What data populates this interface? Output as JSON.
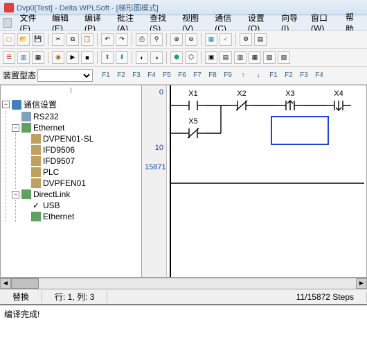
{
  "title": "Dvp0[Test] - Delta WPLSoft - [梯形图模式]",
  "menu": [
    "文件(F)",
    "编辑(E)",
    "编译(P)",
    "批注(A)",
    "查找(S)",
    "视图(V)",
    "通信(C)",
    "设置(Q)",
    "向导(I)",
    "窗口(W)",
    "帮助"
  ],
  "combo": {
    "label": "装置型态",
    "value": ""
  },
  "fkeys": [
    "F1",
    "F2",
    "F3",
    "F4",
    "F5",
    "F6",
    "F7",
    "F8",
    "F9",
    "↑",
    "↓",
    "F1",
    "F2",
    "F3",
    "F4"
  ],
  "tree": {
    "root": "通信设置",
    "rs232": "RS232",
    "ethernet": "Ethernet",
    "eth_children": [
      "DVPEN01-SL",
      "IFD9506",
      "IFD9507",
      "PLC",
      "DVPFEN01"
    ],
    "directlink": "DirectLink",
    "usb": "USB",
    "eth2": "Ethernet"
  },
  "gutter": [
    "0",
    "10",
    "15871"
  ],
  "contacts": {
    "row1": [
      {
        "label": "X1",
        "type": "no"
      },
      {
        "label": "X2",
        "type": "nc"
      },
      {
        "label": "X3",
        "type": "rising"
      },
      {
        "label": "X4",
        "type": "falling"
      }
    ],
    "row2": [
      {
        "label": "X5",
        "type": "nc"
      }
    ]
  },
  "status": {
    "mode": "替换",
    "pos": "行: 1, 列: 3",
    "steps": "11/15872 Steps"
  },
  "output": "编译完成!"
}
